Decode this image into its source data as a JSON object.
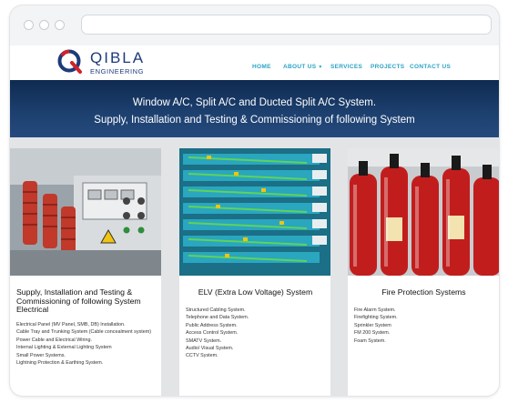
{
  "header": {
    "logo_title": "QIBLA",
    "logo_subtitle": "ENGINEERING",
    "nav": [
      "HOME",
      "ABOUT US",
      "SERVICES",
      "PROJECTS",
      "CONTACT US"
    ]
  },
  "hero": {
    "line1": "Window A/C, Split A/C and Ducted Split A/C System.",
    "line2": "Supply, Installation and Testing & Commissioning of following System"
  },
  "cards": [
    {
      "title": "Supply, Installation and Testing & Commissioning of following System Electrical",
      "image": "electrical-switchgear-photo",
      "items": [
        "Electrical Panel (MV Panel, SMB, DB) Installation.",
        "Cable Tray and Trunking System (Cable concealment system)",
        "Power Cable and Electrical Wiring.",
        "Internal Lighting & External Lighting System",
        "Small Power Systems.",
        "Lightning Protection & Earthing System."
      ]
    },
    {
      "title": "ELV (Extra Low Voltage) System",
      "image": "network-patch-panel-photo",
      "items": [
        "Structured Cabling System.",
        "Telephone and Data System.",
        "Public Address System.",
        "Access Control System.",
        "SMATV System.",
        "Audio/ Visual System.",
        "CCTV System."
      ]
    },
    {
      "title": "Fire Protection Systems",
      "image": "fire-extinguishers-photo",
      "items": [
        "Fire Alarm System.",
        "Firefighting System.",
        "Sprinkler System",
        "FM 200 System.",
        "Foam System."
      ]
    }
  ],
  "colors": {
    "brand": "#1d3b7a",
    "nav": "#2aa3c6",
    "hero": "#1c3f6e",
    "logo_red": "#d2232a"
  }
}
